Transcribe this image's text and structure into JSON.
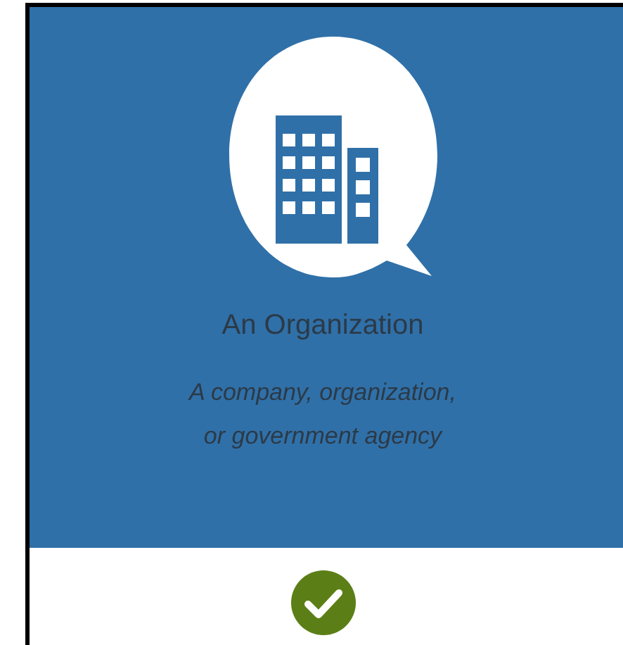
{
  "card": {
    "title": "An Organization",
    "description": "A company, organization,\nor government agency",
    "selected": true
  }
}
